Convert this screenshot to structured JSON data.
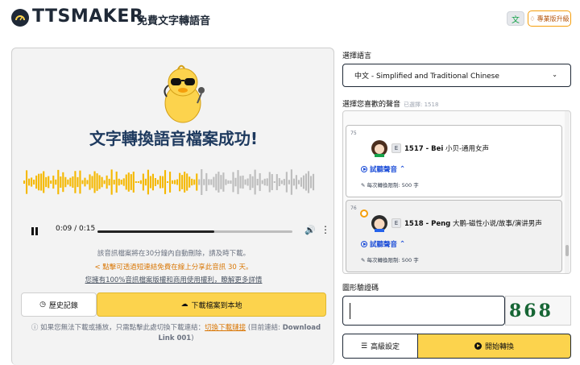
{
  "header": {
    "brand": "TTSMAKER",
    "tagline": "免費文字轉語音",
    "upgrade_label": "專業版升級",
    "language_icon": "translate-icon"
  },
  "result": {
    "title": "文字轉換語音檔案成功!",
    "player": {
      "time": "0:09 / 0:15",
      "progress": 0.6
    },
    "notice_delete": "該音訊檔案將在30分鐘內自動刪除，請及時下載。",
    "notice_share": "點擊可透過短連結免費在線上分享此音訊 30 天。",
    "notice_license": "您擁有100%音訊檔案版權和商用使用權利，瞭解更多詳情",
    "history_label": "歷史記錄",
    "download_label": "下載檔案到本地",
    "footnote_prefix": "如果您無法下載或播放，只需點擊此處切換下載連結：",
    "footnote_link": "切換下載鏈接",
    "footnote_mid": "(目前連結: ",
    "footnote_current": "Download Link 001",
    "footnote_end": ")"
  },
  "settings": {
    "language_label": "選擇語言",
    "language_value": "中文 - Simplified and Traditional Chinese",
    "voice_label": "選擇您喜歡的聲音",
    "voice_count": "已選擇: 1518",
    "voices": [
      {
        "num": "75",
        "tag": "E",
        "id": "1517 - Bei",
        "desc": "小贝-通用女声",
        "preview": "試聽聲音",
        "limit": "每次轉換限制: 500 字",
        "selected": false
      },
      {
        "num": "76",
        "tag": "E",
        "id": "1518 - Peng",
        "desc": "大鹏-磁性小说/故事/演讲男声",
        "preview": "試聽聲音",
        "limit": "每次轉換限制: 500 字",
        "selected": true
      }
    ],
    "captcha_label": "圖形驗證碼",
    "captcha_text": "868",
    "advanced_label": "高級設定",
    "start_label": "開始轉換"
  },
  "colors": {
    "accent": "#fcd34d",
    "link": "#1d4ed8",
    "warning": "#d97706"
  }
}
